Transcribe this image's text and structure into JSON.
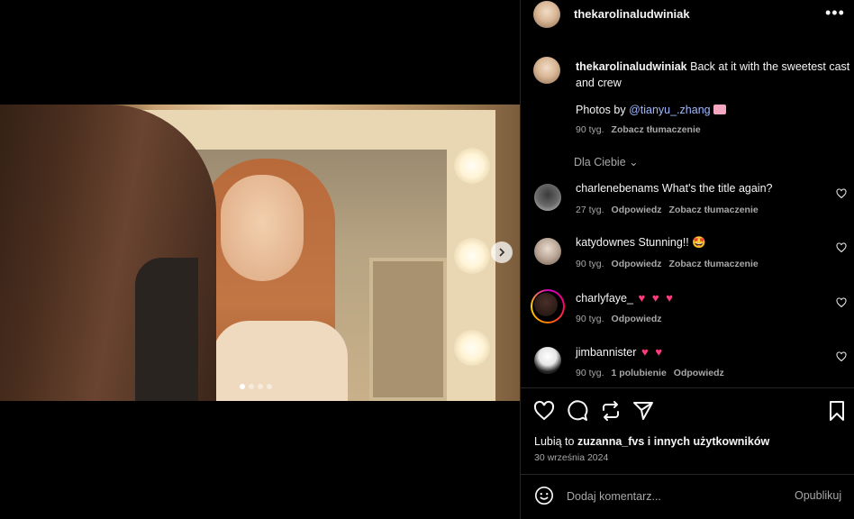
{
  "post": {
    "username": "thekarolinaludwiniak",
    "more_label": "•••",
    "caption_user": "thekarolinaludwiniak",
    "caption_text": " Back at it with the sweetest cast and crew",
    "photos_by_prefix": "Photos by ",
    "photos_by_mention": "@tianyu_.zhang",
    "caption_time": "90 tyg.",
    "caption_translate": "Zobacz tłumaczenie"
  },
  "section_label": "Dla Ciebie",
  "comments": [
    {
      "user": "charlenebenams",
      "text": " What's the title again?",
      "time": "27 tyg.",
      "reply": "Odpowiedz",
      "translate": "Zobacz tłumaczenie"
    },
    {
      "user": "katydownes",
      "text": " Stunning!! 🤩",
      "time": "90 tyg.",
      "reply": "Odpowiedz",
      "translate": "Zobacz tłumaczenie"
    },
    {
      "user": "charlyfaye_",
      "text": " ♥ ♥ ♥",
      "time": "90 tyg.",
      "reply": "Odpowiedz"
    },
    {
      "user": "jimbannister",
      "text": " ♥ ♥",
      "time": "90 tyg.",
      "likes": "1 polubienie",
      "reply": "Odpowiedz"
    }
  ],
  "likes": {
    "prefix": "Lubią to ",
    "user": "zuzanna_fvs",
    "suffix": " i innych użytkowników"
  },
  "date": "30 września 2024",
  "comment_box": {
    "placeholder": "Dodaj komentarz...",
    "post_label": "Opublikuj"
  },
  "carousel": {
    "total": 4,
    "active": 1
  },
  "colors": {
    "background": "#000000",
    "muted": "#a8a8a8",
    "mention": "#a0b8ff",
    "heart": "#ff3b7a"
  }
}
